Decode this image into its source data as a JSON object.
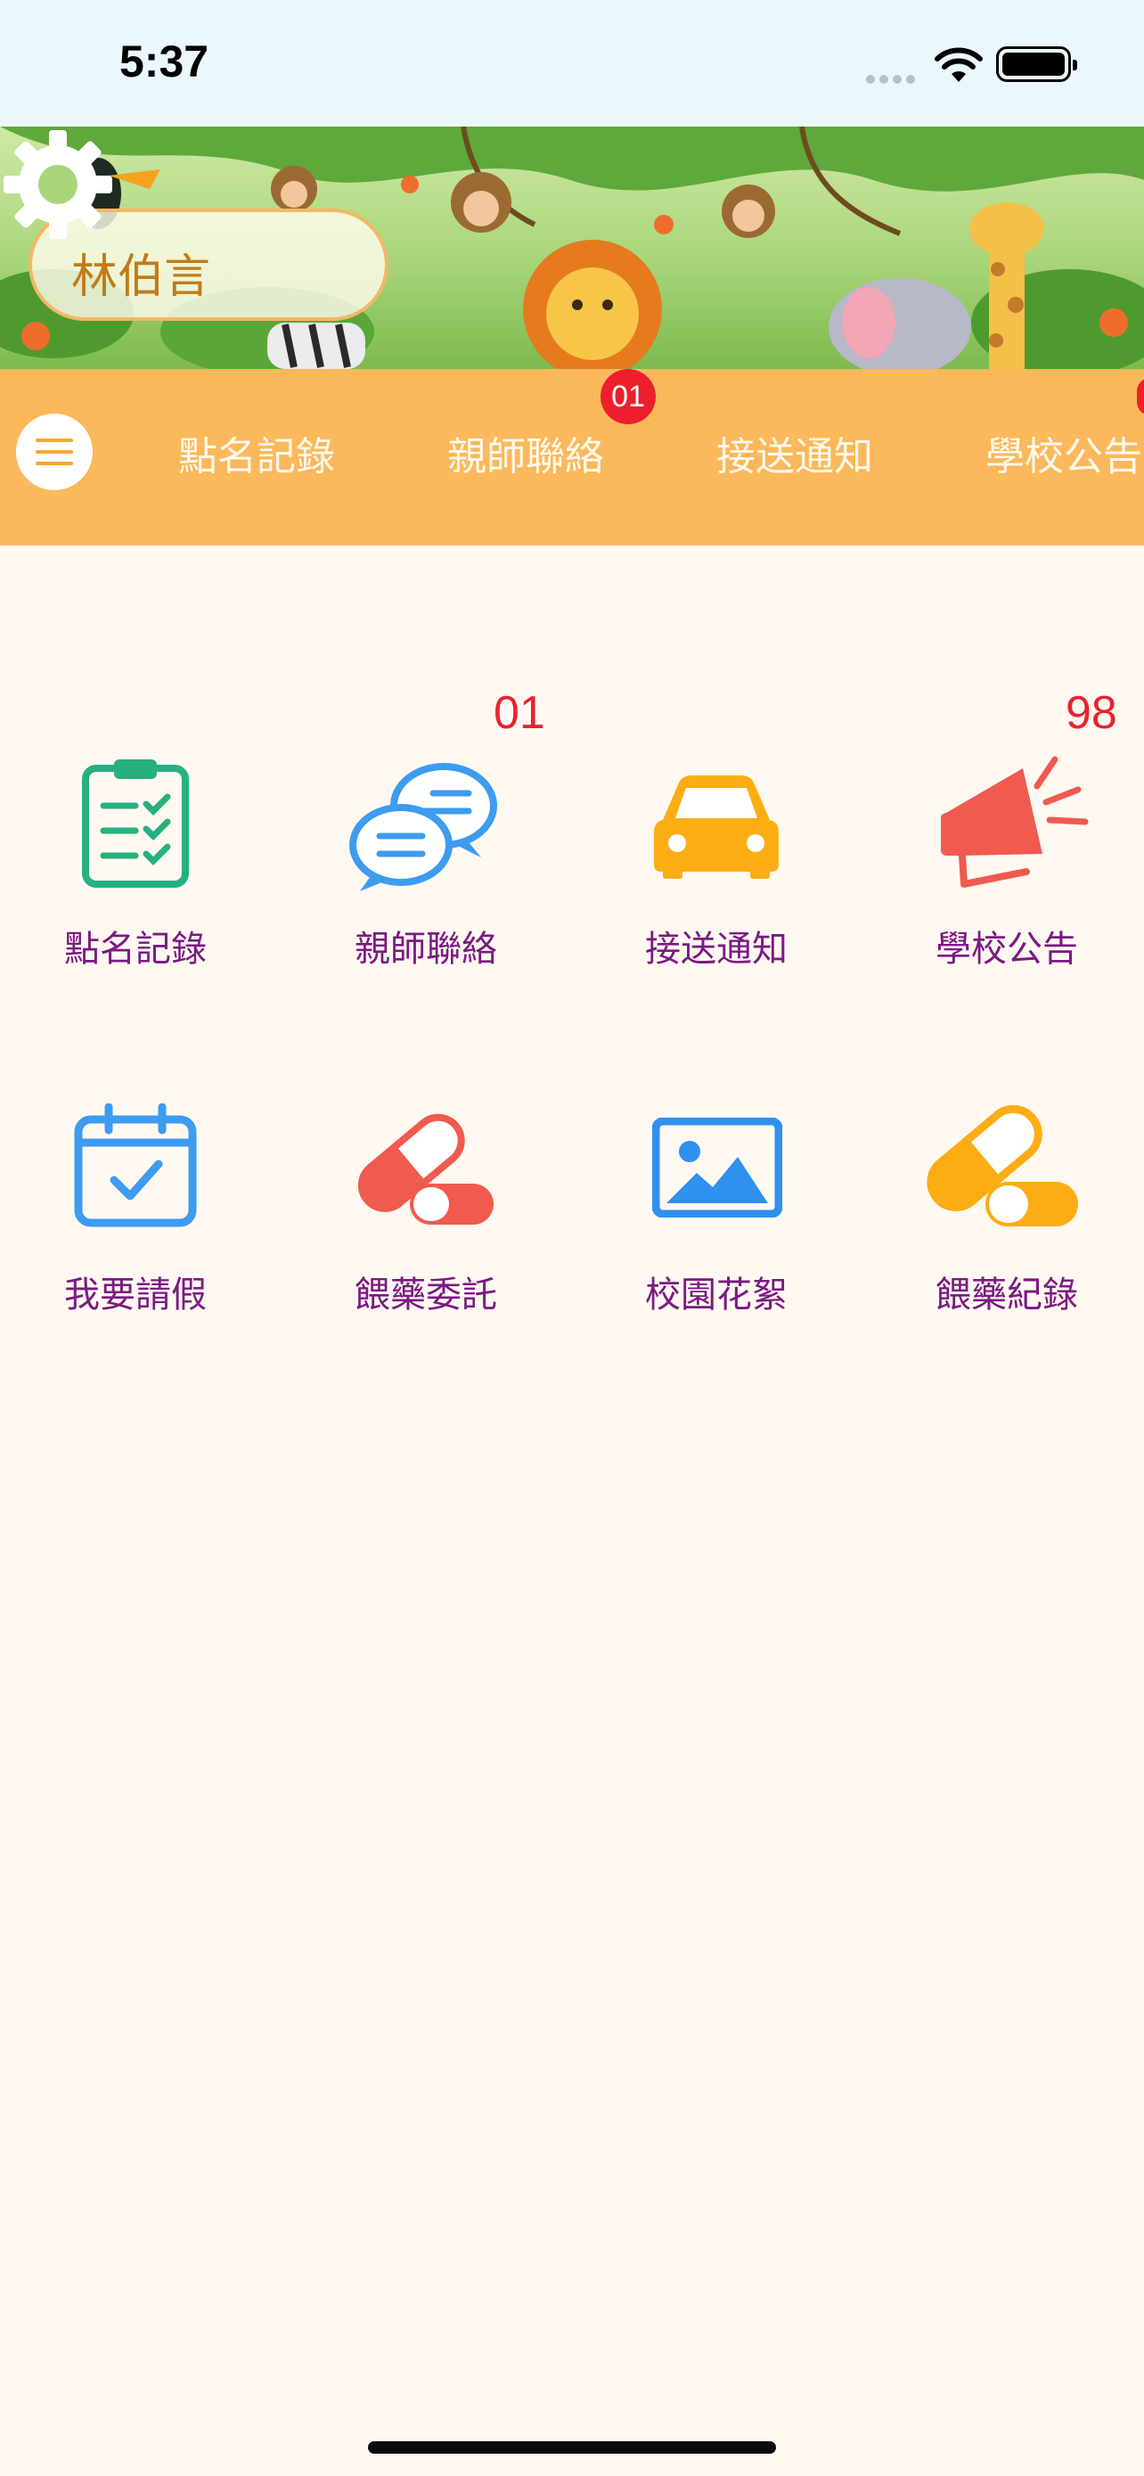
{
  "status_bar": {
    "time": "5:37"
  },
  "header": {
    "user_name": "林伯言"
  },
  "tabs": [
    {
      "label": "點名記錄",
      "badge": ""
    },
    {
      "label": "親師聯絡",
      "badge": "01"
    },
    {
      "label": "接送通知",
      "badge": ""
    },
    {
      "label": "學校公告",
      "badge": ""
    }
  ],
  "menu_items": [
    {
      "label": "點名記錄",
      "badge": "",
      "icon": "checklist-icon",
      "color": "#27b07e"
    },
    {
      "label": "親師聯絡",
      "badge": "01",
      "icon": "chat-bubbles-icon",
      "color": "#3d9bf0"
    },
    {
      "label": "接送通知",
      "badge": "",
      "icon": "car-icon",
      "color": "#fdad13"
    },
    {
      "label": "學校公告",
      "badge": "98",
      "icon": "megaphone-icon",
      "color": "#f05a4f"
    },
    {
      "label": "我要請假",
      "badge": "",
      "icon": "calendar-check-icon",
      "color": "#3d9bf0"
    },
    {
      "label": "餵藥委託",
      "badge": "",
      "icon": "pill-icon",
      "color": "#f05a4f"
    },
    {
      "label": "校園花絮",
      "badge": "",
      "icon": "photo-icon",
      "color": "#2f90f0"
    },
    {
      "label": "餵藥紀錄",
      "badge": "",
      "icon": "pill-icon",
      "color": "#fdad13"
    }
  ],
  "colors": {
    "tab_bar": "#fbb85c",
    "background": "#fff9f2",
    "label_text": "#7b1a82",
    "badge": "#ee1f2b"
  }
}
